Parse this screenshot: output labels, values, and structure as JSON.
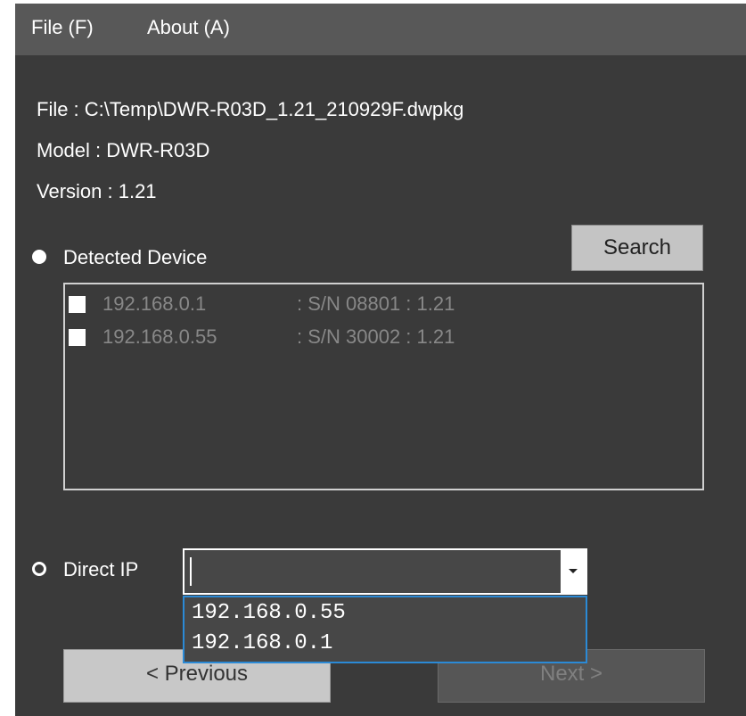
{
  "menu": {
    "file": "File (F)",
    "about": "About (A)"
  },
  "info": {
    "file": "File : C:\\Temp\\DWR-R03D_1.21_210929F.dwpkg",
    "model": "Model : DWR-R03D",
    "version": "Version :  1.21"
  },
  "detected": {
    "label": "Detected Device",
    "selected": true
  },
  "search_label": "Search",
  "devices": [
    {
      "ip": "192.168.0.1",
      "info": ": S/N 08801 : 1.21",
      "checked": false
    },
    {
      "ip": "192.168.0.55",
      "info": ": S/N 30002 : 1.21",
      "checked": false
    }
  ],
  "direct": {
    "label": "Direct IP",
    "selected": false,
    "value": ""
  },
  "dropdown_options": [
    "192.168.0.55",
    "192.168.0.1"
  ],
  "buttons": {
    "previous": "< Previous",
    "next": "Next >"
  },
  "colors": {
    "window_bg": "#3a3a3a",
    "menubar_bg": "#585858",
    "dropdown_border": "#2b8ad6"
  },
  "icons": {
    "dropdown": "chevron-down-icon",
    "radio": "radio-button"
  }
}
